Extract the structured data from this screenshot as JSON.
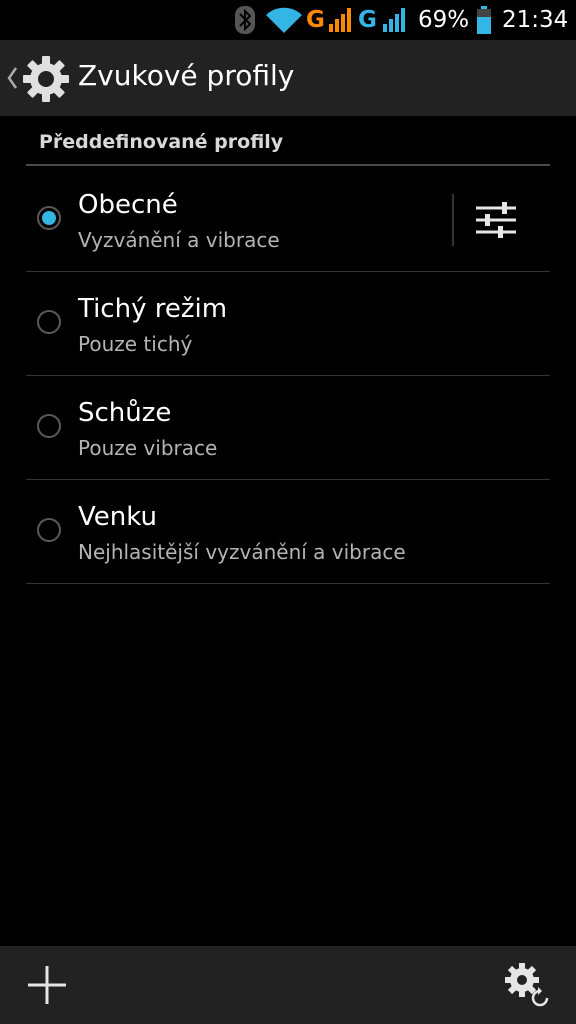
{
  "status_bar": {
    "icons": [
      "bluetooth-icon",
      "wifi-icon",
      "signal-icon",
      "signal-icon",
      "battery-icon"
    ],
    "network1": "G",
    "network2": "G",
    "battery_percent": "69%",
    "time": "21:34",
    "colors": {
      "wifi": "#33b5e5",
      "network1": "#ff8800",
      "network2": "#33b5e5"
    }
  },
  "action_bar": {
    "title": "Zvukové profily",
    "icons": [
      "back-chevron-icon",
      "gear-icon"
    ]
  },
  "section": {
    "header": "Předdefinované profily"
  },
  "profiles": [
    {
      "name": "Obecné",
      "description": "Vyzvánění a vibrace",
      "selected": true
    },
    {
      "name": "Tichý režim",
      "description": "Pouze tichý",
      "selected": false
    },
    {
      "name": "Schůze",
      "description": "Pouze vibrace",
      "selected": false
    },
    {
      "name": "Venku",
      "description": "Nejhlasitější vyzvánění a vibrace",
      "selected": false
    }
  ],
  "bottom_bar": {
    "icons": [
      "add-icon",
      "gear-reset-icon"
    ]
  },
  "colors": {
    "accent": "#33b5e5",
    "background": "#000000",
    "bar": "#222222"
  }
}
